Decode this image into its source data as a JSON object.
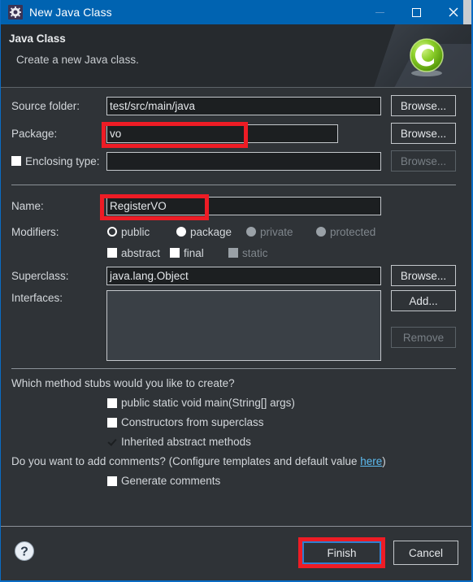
{
  "window": {
    "title": "New Java Class",
    "icon": "gear-icon",
    "controls": {
      "minimize": "–",
      "maximize": "□",
      "close": "✕"
    }
  },
  "banner": {
    "title": "Java Class",
    "subtitle": "Create a new Java class.",
    "icon": "java-class-green-c-icon"
  },
  "form": {
    "source_folder": {
      "label": "Source folder:",
      "value": "test/src/main/java",
      "button": "Browse..."
    },
    "package": {
      "label": "Package:",
      "value": "vo",
      "button": "Browse...",
      "highlighted": true
    },
    "enclosing_type": {
      "label": "Enclosing type:",
      "value": "",
      "button": "Browse...",
      "checked": false,
      "button_disabled": true
    },
    "name": {
      "label": "Name:",
      "value": "RegisterVO",
      "highlighted": true
    },
    "modifiers": {
      "label": "Modifiers:",
      "access": [
        {
          "label": "public",
          "selected": true,
          "disabled": false
        },
        {
          "label": "package",
          "selected": false,
          "disabled": false
        },
        {
          "label": "private",
          "selected": false,
          "disabled": true
        },
        {
          "label": "protected",
          "selected": false,
          "disabled": true
        }
      ],
      "flags": [
        {
          "label": "abstract",
          "checked": false,
          "disabled": false
        },
        {
          "label": "final",
          "checked": false,
          "disabled": false
        },
        {
          "label": "static",
          "checked": false,
          "disabled": true
        }
      ]
    },
    "superclass": {
      "label": "Superclass:",
      "value": "java.lang.Object",
      "button": "Browse..."
    },
    "interfaces": {
      "label": "Interfaces:",
      "value": "",
      "add_button": "Add...",
      "remove_button": "Remove",
      "remove_disabled": true
    }
  },
  "stubs": {
    "question": "Which method stubs would you like to create?",
    "items": [
      {
        "label": "public static void main(String[] args)",
        "checked": false
      },
      {
        "label": "Constructors from superclass",
        "checked": false
      },
      {
        "label": "Inherited abstract methods",
        "checked": true
      }
    ]
  },
  "comments": {
    "question_pre": "Do you want to add comments? (Configure templates and default value ",
    "link": "here",
    "question_post": ")",
    "generate": {
      "label": "Generate comments",
      "checked": false
    }
  },
  "footer": {
    "help": "?",
    "finish": "Finish",
    "cancel": "Cancel",
    "finish_highlighted": true
  },
  "colors": {
    "titlebar": "#0063b1",
    "dialog_bg": "#2f3337",
    "banner_bg": "#262a2e",
    "field_bg": "#1c1f21",
    "text": "#d3d7db",
    "highlight_red": "#ee1c25",
    "link_blue": "#5dbcf0",
    "focus_blue": "#2f7fd0"
  }
}
